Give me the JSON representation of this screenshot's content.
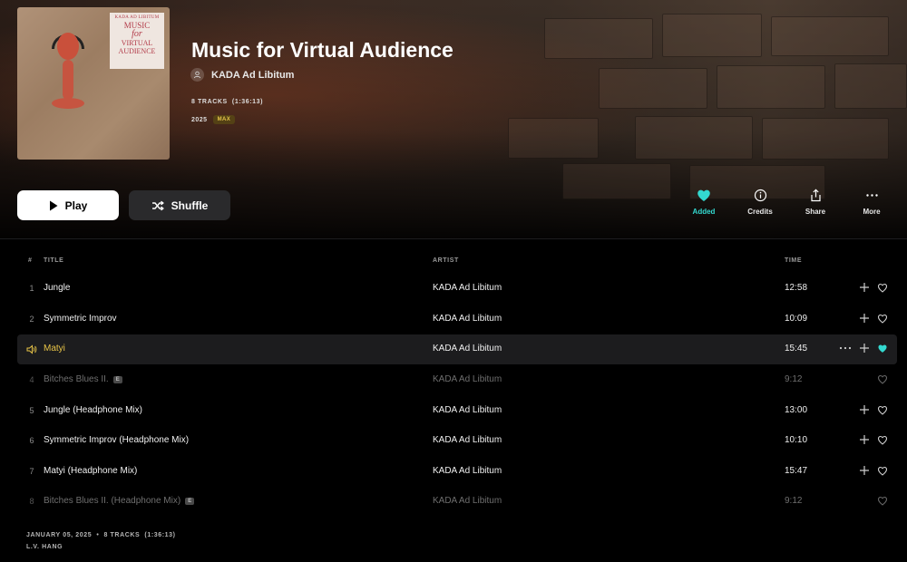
{
  "album": {
    "title": "Music for Virtual Audience",
    "artist": "KADA Ad Libitum",
    "tracks_summary": "8 TRACKS",
    "duration_summary": "(1:36:13)",
    "year": "2025",
    "quality_badge": "MAX",
    "cover": {
      "label_line1": "KADA AD LIBITUM",
      "label_line2": "MUSIC",
      "label_line3": "for",
      "label_line4": "VIRTUAL",
      "label_line5": "AUDIENCE"
    }
  },
  "buttons": {
    "play_label": "Play",
    "shuffle_label": "Shuffle"
  },
  "actions": {
    "added_label": "Added",
    "credits_label": "Credits",
    "share_label": "Share",
    "more_label": "More"
  },
  "table": {
    "headers": {
      "num": "#",
      "title": "TITLE",
      "artist": "ARTIST",
      "time": "TIME"
    },
    "rows": [
      {
        "num": "1",
        "title": "Jungle",
        "artist": "KADA Ad Libitum",
        "time": "12:58"
      },
      {
        "num": "2",
        "title": "Symmetric Improv",
        "artist": "KADA Ad Libitum",
        "time": "10:09"
      },
      {
        "num": "3",
        "title": "Matyi",
        "artist": "KADA Ad Libitum",
        "time": "15:45"
      },
      {
        "num": "4",
        "title": "Bitches Blues II.",
        "explicit": "E",
        "artist": "KADA Ad Libitum",
        "time": "9:12"
      },
      {
        "num": "5",
        "title": "Jungle (Headphone Mix)",
        "artist": "KADA Ad Libitum",
        "time": "13:00"
      },
      {
        "num": "6",
        "title": "Symmetric Improv (Headphone Mix)",
        "artist": "KADA Ad Libitum",
        "time": "10:10"
      },
      {
        "num": "7",
        "title": "Matyi (Headphone Mix)",
        "artist": "KADA Ad Libitum",
        "time": "15:47"
      },
      {
        "num": "8",
        "title": "Bitches Blues II. (Headphone Mix)",
        "explicit": "E",
        "artist": "KADA Ad Libitum",
        "time": "9:12"
      }
    ]
  },
  "footer": {
    "release_date": "JANUARY 05, 2025",
    "separator": "•",
    "tracks": "8 TRACKS",
    "duration": "(1:36:13)",
    "label": "L.V. HANG"
  },
  "colors": {
    "accent_added": "#33d9d0",
    "now_playing": "#e8c447",
    "max_badge": "#e4c34a"
  },
  "icons": [
    "user-icon",
    "play-icon",
    "shuffle-icon",
    "heart-icon",
    "info-icon",
    "share-icon",
    "more-icon",
    "speaker-icon",
    "plus-icon",
    "heart-outline-icon",
    "explicit-badge"
  ]
}
